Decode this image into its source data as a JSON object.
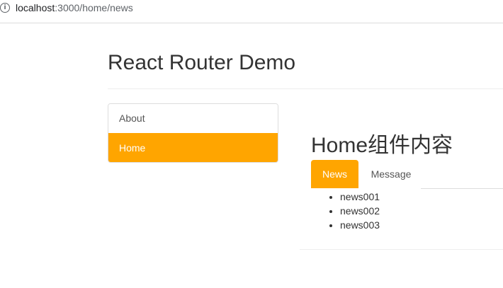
{
  "browser": {
    "url_host": "localhost",
    "url_path": ":3000/home/news"
  },
  "page": {
    "title": "React Router Demo"
  },
  "nav": {
    "items": [
      {
        "label": "About",
        "active": false
      },
      {
        "label": "Home",
        "active": true
      }
    ]
  },
  "home": {
    "title": "Home组件内容",
    "tabs": [
      {
        "label": "News",
        "active": true
      },
      {
        "label": "Message",
        "active": false
      }
    ],
    "news": [
      "news001",
      "news002",
      "news003"
    ]
  },
  "colors": {
    "accent": "#ffa500",
    "text": "#333333",
    "border": "#dddddd"
  },
  "icons": {
    "address_bar": "info-icon"
  }
}
